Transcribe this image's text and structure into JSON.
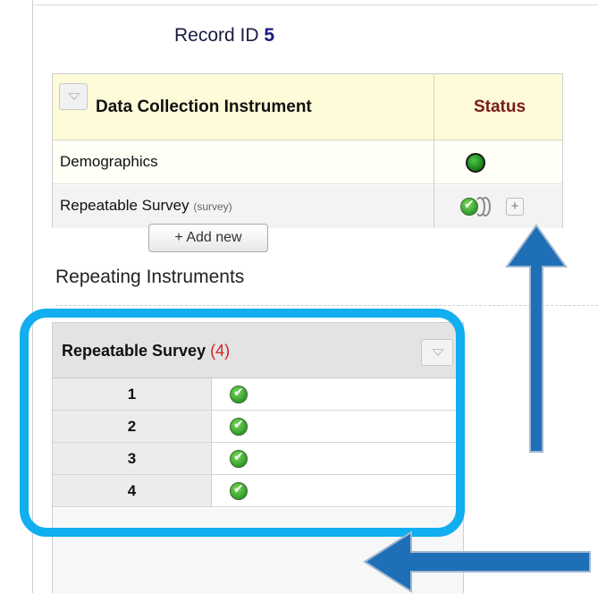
{
  "record": {
    "label": "Record ID",
    "id": "5"
  },
  "instrument_table": {
    "header_instrument": "Data Collection Instrument",
    "header_status": "Status",
    "rows": [
      {
        "name": "Demographics",
        "suffix": "",
        "status": "complete"
      },
      {
        "name": "Repeatable Survey",
        "suffix": "(survey)",
        "status": "survey-complete-multiple"
      }
    ],
    "add_instance_label": "+"
  },
  "repeating": {
    "heading": "Repeating Instruments",
    "table_title": "Repeatable Survey",
    "count_label": "(4)",
    "rows": [
      {
        "num": "1",
        "status": "survey-complete"
      },
      {
        "num": "2",
        "status": "survey-complete"
      },
      {
        "num": "3",
        "status": "survey-complete"
      },
      {
        "num": "4",
        "status": "survey-complete"
      }
    ],
    "add_new_label": "+ Add new"
  },
  "colors": {
    "highlight": "#11aef0",
    "arrow": "#1f6fb7",
    "status_header": "#7a1a1a",
    "count": "#d42020"
  }
}
